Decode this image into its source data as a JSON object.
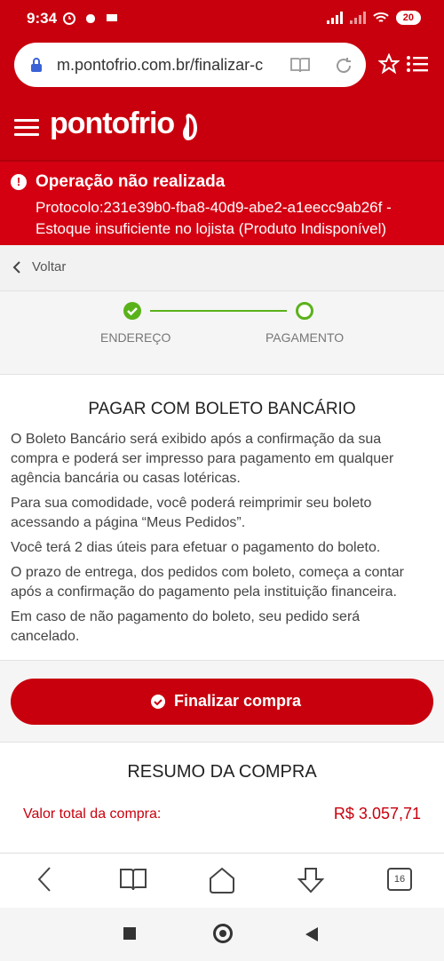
{
  "status_bar": {
    "time": "9:34",
    "battery": "20",
    "icons_left": [
      "alarm-icon",
      "hand-icon",
      "chat-icon"
    ],
    "icons_right": [
      "signal-icon",
      "signal-icon",
      "wifi-icon",
      "battery-icon"
    ]
  },
  "browser": {
    "url": "m.pontofrio.com.br/finalizar-c",
    "tab_count": "16"
  },
  "site": {
    "logo": "pontofrio"
  },
  "error": {
    "title": "Operação não realizada",
    "line1": "Protocolo:231e39b0-fba8-40d9-abe2-a1eecc9ab26f -",
    "line2": "Estoque insuficiente no lojista (Produto Indisponível)"
  },
  "nav": {
    "back_label": "Voltar"
  },
  "stepper": {
    "step1": "ENDEREÇO",
    "step2": "PAGAMENTO"
  },
  "boleto": {
    "title": "PAGAR COM BOLETO BANCÁRIO",
    "p1_l1": "O Boleto Bancário será exibido após a confirmação da sua",
    "p1_l2": "compra e poderá ser impresso para pagamento em qualquer",
    "p1_l3": "agência bancária ou casas lotéricas.",
    "p2_l1": "Para sua comodidade, você poderá reimprimir seu boleto",
    "p2_l2": "acessando a página “Meus Pedidos”.",
    "p3_l1": "Você terá 2 dias úteis para efetuar o pagamento do boleto.",
    "p4_l1": "O prazo de entrega, dos pedidos com boleto, começa a contar",
    "p4_l2": "após a confirmação do pagamento pela instituição financeira.",
    "p5_l1": "Em caso de não pagamento do boleto, seu pedido será",
    "p5_l2": "cancelado."
  },
  "actions": {
    "finalize_label": "Finalizar compra"
  },
  "resumo": {
    "title": "RESUMO DA COMPRA",
    "total_label": "Valor total da compra:",
    "total_value": "R$ 3.057,71"
  },
  "colors": {
    "brand": "#c8000d",
    "success": "#5ab21b"
  }
}
